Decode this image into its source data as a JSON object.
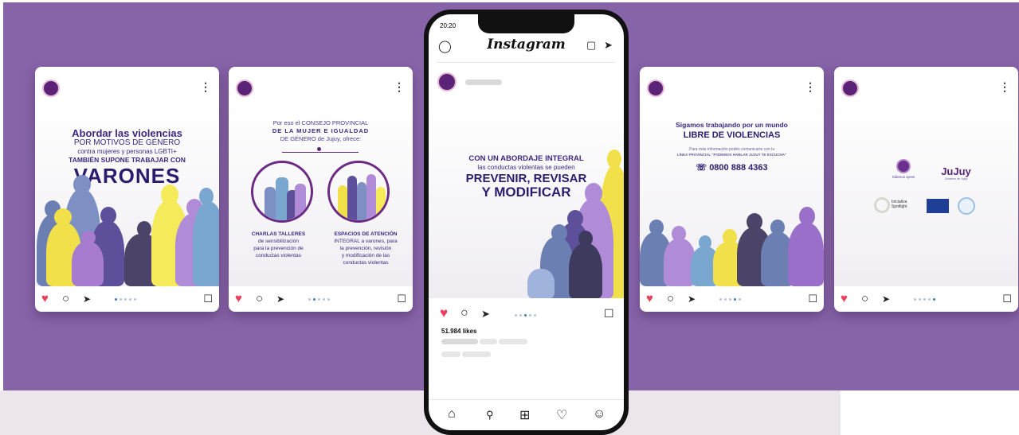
{
  "colors": {
    "background": "#8763a8",
    "heart": "#e8415d",
    "brand_purple": "#3d2780"
  },
  "cards": [
    {
      "line1": "Abordar las violencias",
      "line2": "POR MOTIVOS DE GÉNERO",
      "line3": "contra mujeres y personas LGBTI+",
      "line4": "TAMBIÉN SUPONE TRABAJAR CON",
      "big": "VARONES"
    },
    {
      "intro1": "Por eso el CONSEJO PROVINCIAL",
      "intro2": "DE LA MUJER E IGUALDAD",
      "intro3": "DE GÉNERO de Jujuy, ofrece:",
      "left1": "CHARLAS TALLERES",
      "left2": "de sensibilización",
      "left3": "para la prevención de",
      "left4": "conductas violentas",
      "right1": "ESPACIOS DE ATENCIÓN",
      "right2": "INTEGRAL a varones, para",
      "right3": "la prevención, revisión",
      "right4": "y modificación de las",
      "right5": "conductas violentas"
    },
    {
      "line1": "Sigamos trabajando por un mundo",
      "line2": "LIBRE DE VIOLENCIAS",
      "line3": "Para más información podés comunicarte con la",
      "line4": "LÍNEA PROVINCIAL \"PODEMOS HABLAR JUJUY TE ESCUCHA\"",
      "phone": "0800 888 4363"
    },
    {
      "logo1": "Súlenos ayres",
      "logo2": "JuJuy",
      "logo2_sub": "Gobierno de Jujuy",
      "logo3": "Iniciativa Spotlight"
    }
  ],
  "phone": {
    "time": "20:20",
    "app_title": "Instagram",
    "post_line1": "CON UN ABORDAJE INTEGRAL",
    "post_line2": "las conductas violentas se pueden",
    "post_line3": "PREVENIR, REVISAR",
    "post_line4": "Y MODIFICAR",
    "likes": "51.984 likes"
  },
  "icons": {
    "menu": "⋮",
    "heart": "♥",
    "comment": "○",
    "share": "➤",
    "bookmark": "🔖",
    "camera": "camera-icon",
    "messenger": "messenger-icon",
    "home": "home-icon",
    "search": "search-icon",
    "add": "add-icon",
    "activity": "heart-icon",
    "profile": "profile-icon"
  }
}
